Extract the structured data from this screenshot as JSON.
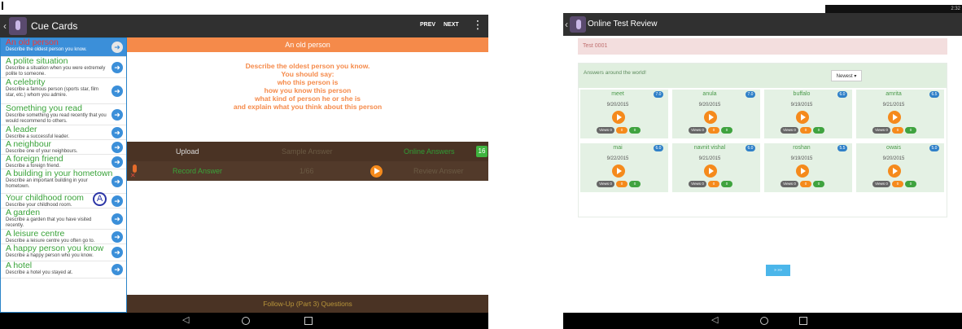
{
  "left": {
    "app_title": "Cue Cards",
    "prev_label": "PREV",
    "next_label": "NEXT",
    "list": [
      {
        "title": "An old person",
        "desc": "Describe the oldest person you know.",
        "selected": true
      },
      {
        "title": "A polite situation",
        "desc": "Describe a situation when you were extremely polite to someone."
      },
      {
        "title": "A celebrity",
        "desc": "Describe a famous person (sports star, film star, etc.) whom you admire."
      },
      {
        "title": "Something you read",
        "desc": "Describe something you read recently that you would recommend to others."
      },
      {
        "title": "A leader",
        "desc": "Describe a successful leader."
      },
      {
        "title": "A neighbour",
        "desc": "Describe one of your neighbours."
      },
      {
        "title": "A foreign friend",
        "desc": "Describe a foreign friend."
      },
      {
        "title": "A building in your hometown",
        "desc": "Describe an important building in your hometown."
      },
      {
        "title": "Your childhood room",
        "desc": "Describe your childhood room."
      },
      {
        "title": "A garden",
        "desc": "Describe a garden that you have visited recently."
      },
      {
        "title": "A leisure centre",
        "desc": "Describe a leisure centre you often go to."
      },
      {
        "title": "A happy person you know",
        "desc": "Describe a happy person who you know."
      },
      {
        "title": "A hotel",
        "desc": "Describe a hotel you stayed at."
      }
    ],
    "marker": "A",
    "detail_title": "An old person",
    "detail_lines": [
      "Describe the oldest person you know.",
      "You should say:",
      "who this person is",
      "how you know this person",
      "what kind of person he or she is",
      "and explain what you think about this person"
    ],
    "upload": "Upload",
    "sample_answer": "Sample Answer",
    "online_answers": "Online Answers",
    "online_count": "16",
    "record_answer": "Record Answer",
    "counter": "1/66",
    "review_answer": "Review Answer",
    "followup": "Follow-Up (Part 3) Questions"
  },
  "right": {
    "status_time": "2:32",
    "app_title": "Online Test Review",
    "test_label": "Test 0001",
    "answers_title": "Answers around the world!",
    "sort_label": "Newest ▾",
    "cards": [
      {
        "name": "meet",
        "score": "7.0",
        "date": "9/20/2015",
        "views": "Views 0",
        "b1": "0",
        "b2": "0"
      },
      {
        "name": "anula",
        "score": "7.0",
        "date": "9/20/2015",
        "views": "Views 0",
        "b1": "0",
        "b2": "0"
      },
      {
        "name": "buffalo",
        "score": "6.0",
        "date": "9/19/2015",
        "views": "Views 0",
        "b1": "0",
        "b2": "0"
      },
      {
        "name": "amrita",
        "score": "6.5",
        "date": "9/21/2015",
        "views": "Views 0",
        "b1": "0",
        "b2": "0"
      },
      {
        "name": "mai",
        "score": "6.0",
        "date": "9/22/2015",
        "views": "Views 0",
        "b1": "0",
        "b2": "0"
      },
      {
        "name": "navnit vishal",
        "score": "6.0",
        "date": "9/21/2015",
        "views": "Views 0",
        "b1": "0",
        "b2": "0"
      },
      {
        "name": "roshan",
        "score": "5.5",
        "date": "9/19/2015",
        "views": "Views 0",
        "b1": "0",
        "b2": "0"
      },
      {
        "name": "owais",
        "score": "5.0",
        "date": "9/20/2015",
        "views": "Views 0",
        "b1": "0",
        "b2": "0"
      }
    ],
    "pagination": "» »»"
  },
  "nav": {
    "back": "◁"
  },
  "icons": [
    "back-chevron-icon",
    "app-icon",
    "overflow-menu-icon",
    "arrow-right-icon",
    "microphone-icon",
    "play-icon",
    "nav-back-icon",
    "nav-home-icon",
    "nav-recents-icon"
  ],
  "colors": {
    "accent_blue": "#3b8fd9",
    "orange": "#f58a4a",
    "green": "#3aa33a",
    "brown": "#4a3324"
  }
}
